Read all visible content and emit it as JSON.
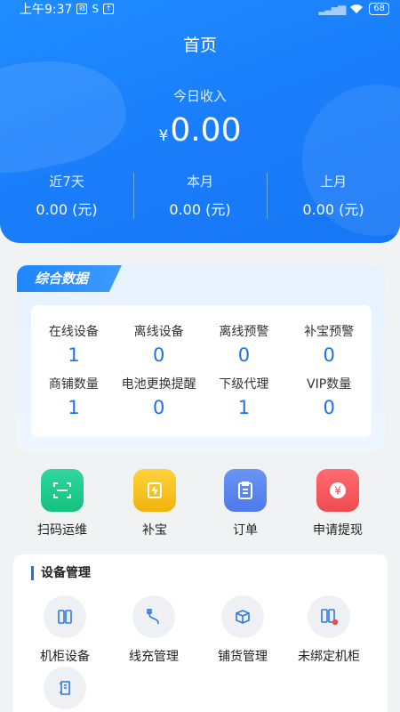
{
  "status_bar": {
    "time": "上午9:37",
    "battery": "68"
  },
  "header": {
    "title": "首页",
    "today_label": "今日收入",
    "currency": "¥",
    "today_value": "0.00",
    "stats": [
      {
        "label": "近7天",
        "value": "0.00 (元)"
      },
      {
        "label": "本月",
        "value": "0.00 (元)"
      },
      {
        "label": "上月",
        "value": "0.00 (元)"
      }
    ]
  },
  "summary": {
    "tag": "综合数据",
    "cells": [
      {
        "label": "在线设备",
        "value": "1"
      },
      {
        "label": "离线设备",
        "value": "0"
      },
      {
        "label": "离线预警",
        "value": "0"
      },
      {
        "label": "补宝预警",
        "value": "0"
      },
      {
        "label": "商铺数量",
        "value": "1"
      },
      {
        "label": "电池更换提醒",
        "value": "0"
      },
      {
        "label": "下级代理",
        "value": "1"
      },
      {
        "label": "VIP数量",
        "value": "0"
      }
    ]
  },
  "actions": [
    {
      "label": "扫码运维",
      "icon": "scan-icon",
      "color": "#1ecc8c"
    },
    {
      "label": "补宝",
      "icon": "powerbank-icon",
      "color": "#f5c11a"
    },
    {
      "label": "订单",
      "icon": "clipboard-icon",
      "color": "#5a87f0"
    },
    {
      "label": "申请提现",
      "icon": "yuan-icon",
      "color": "#f45a5f"
    }
  ],
  "device_mgmt": {
    "title": "设备管理",
    "items": [
      {
        "label": "机柜设备",
        "icon": "cabinet-icon"
      },
      {
        "label": "线充管理",
        "icon": "cable-icon"
      },
      {
        "label": "铺货管理",
        "icon": "box-icon"
      },
      {
        "label": "未绑定机柜",
        "icon": "unbound-cabinet-icon"
      },
      {
        "label": "",
        "icon": "scroll-icon"
      }
    ]
  },
  "colors": {
    "primary": "#1a7dfa",
    "value_blue": "#1a73e8"
  }
}
